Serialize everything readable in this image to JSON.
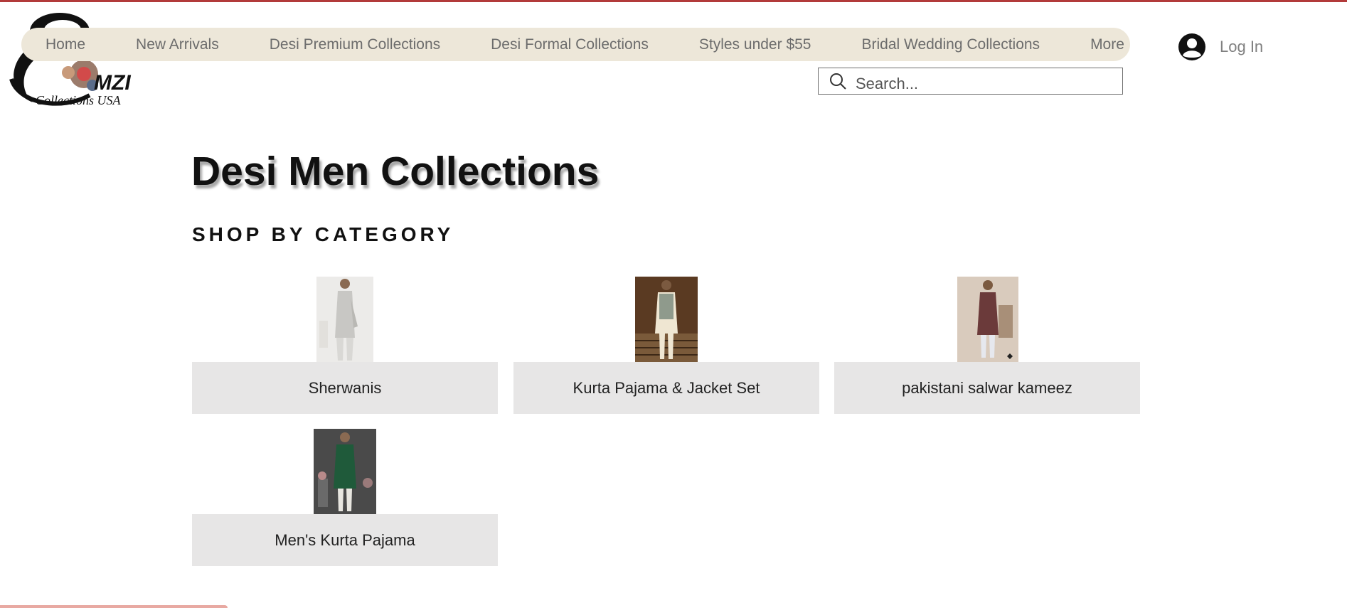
{
  "brand": {
    "logo_text": "MZI",
    "logo_subtext": "Collections USA"
  },
  "nav": {
    "items": [
      {
        "label": "Home"
      },
      {
        "label": "New Arrivals"
      },
      {
        "label": "Desi Premium Collections"
      },
      {
        "label": "Desi Formal Collections"
      },
      {
        "label": "Styles under $55"
      },
      {
        "label": "Bridal Wedding Collections"
      },
      {
        "label": "More"
      }
    ]
  },
  "login": {
    "label": "Log In",
    "icon": "user-avatar-icon"
  },
  "search": {
    "placeholder": "Search...",
    "value": "",
    "icon": "search-icon"
  },
  "page": {
    "title": "Desi Men Collections",
    "section_title": "SHOP BY CATEGORY"
  },
  "categories": [
    {
      "label": "Sherwanis"
    },
    {
      "label": "Kurta Pajama & Jacket Set"
    },
    {
      "label": "pakistani salwar kameez"
    },
    {
      "label": "Men's Kurta Pajama"
    }
  ],
  "colors": {
    "accent_line": "#b23a3a",
    "nav_background": "#ede7d9",
    "card_label_background": "#e7e6e6",
    "bottom_strip": "#e8a9a2"
  }
}
